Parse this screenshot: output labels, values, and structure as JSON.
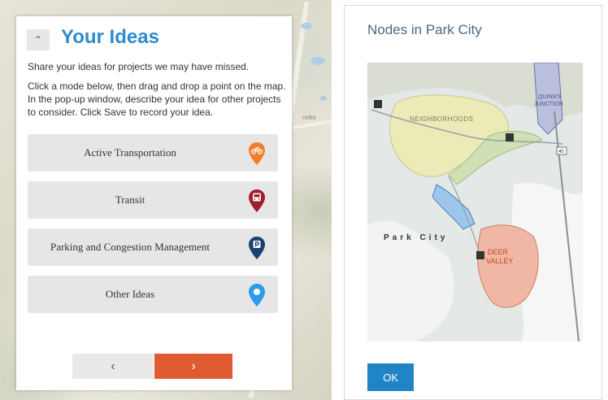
{
  "ideas_panel": {
    "collapse_glyph": "⌃",
    "title": "Your Ideas",
    "intro": "Share your ideas for projects we may have missed.",
    "instructions": "Click a mode below, then drag and drop a point on the map. In the pop-up window, describe your idea for other projects to consider. Click Save to record your idea.",
    "modes": [
      {
        "label": "Active Transportation",
        "icon": "bicycle-pin-icon",
        "color": "#f07f2a"
      },
      {
        "label": "Transit",
        "icon": "bus-pin-icon",
        "color": "#a01f28"
      },
      {
        "label": "Parking and Congestion Management",
        "icon": "parking-pin-icon",
        "color": "#1c3f78"
      },
      {
        "label": "Other Ideas",
        "icon": "location-pin-icon",
        "color": "#2b9bea"
      }
    ],
    "prev_glyph": "‹",
    "next_glyph": "›",
    "next_color": "#e05a32"
  },
  "background_map": {
    "labels": [
      "rwke"
    ]
  },
  "dialog": {
    "title": "Nodes in Park City",
    "ok_label": "OK",
    "map": {
      "labels": {
        "neighborhoods": "NEIGHBORHOODS",
        "quinns_1": "QUINN'S",
        "quinns_2": "JUNCTION",
        "park_city": "Park City",
        "deer_1": "DEER",
        "deer_2": "VALLEY",
        "route": "40"
      }
    }
  }
}
